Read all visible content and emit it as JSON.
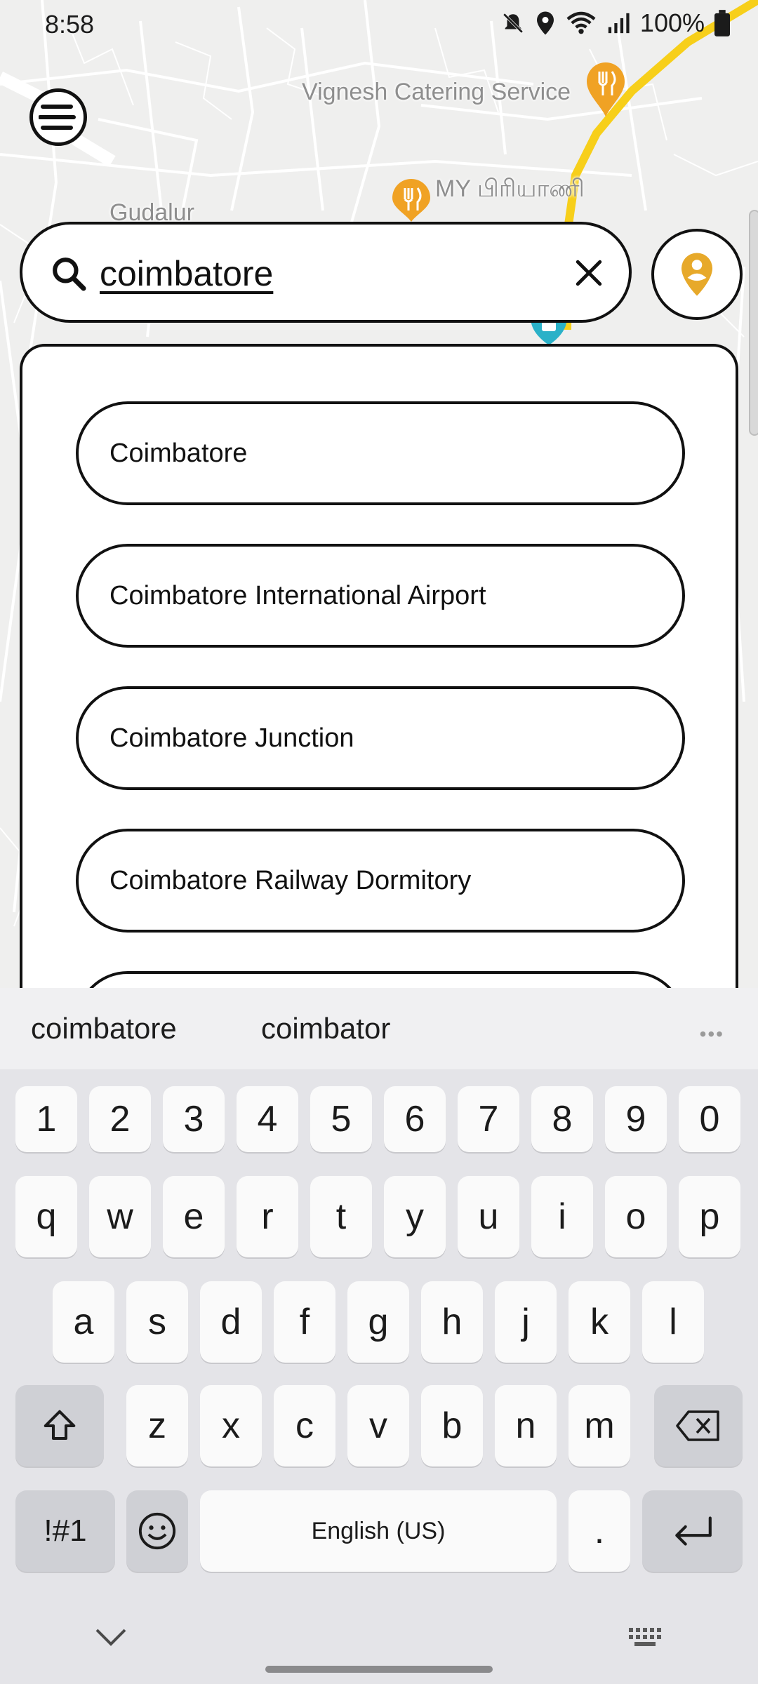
{
  "status_bar": {
    "time": "8:58",
    "battery_text": "100%",
    "icons": [
      "mute-icon",
      "location-icon",
      "wifi-icon",
      "signal-icon",
      "battery-icon"
    ]
  },
  "map": {
    "labels": {
      "vignesh": "Vignesh Catering Service",
      "my_biryani": "MY பிரியாணி",
      "gudalur": "Gudalur"
    },
    "colors": {
      "road_main": "#f7cf1a",
      "poi": "#f0a224",
      "transit": "#2ab1c8"
    }
  },
  "menu_button": {
    "icon": "menu-icon"
  },
  "search": {
    "value": "coimbatore",
    "clear_icon": "close-icon",
    "search_icon": "search-icon"
  },
  "location_button": {
    "icon": "person-pin-icon",
    "color": "#e7a92a"
  },
  "suggestions": [
    {
      "label": "Coimbatore"
    },
    {
      "label": "Coimbatore International Airport"
    },
    {
      "label": "Coimbatore Junction"
    },
    {
      "label": "Coimbatore Railway Dormitory"
    },
    {
      "label": ""
    }
  ],
  "keyboard": {
    "predictions": [
      "coimbatore",
      "coimbator"
    ],
    "more_icon": "more-horizontal-icon",
    "rows": {
      "numbers": [
        "1",
        "2",
        "3",
        "4",
        "5",
        "6",
        "7",
        "8",
        "9",
        "0"
      ],
      "row1": [
        "q",
        "w",
        "e",
        "r",
        "t",
        "y",
        "u",
        "i",
        "o",
        "p"
      ],
      "row2": [
        "a",
        "s",
        "d",
        "f",
        "g",
        "h",
        "j",
        "k",
        "l"
      ],
      "row3": [
        "z",
        "x",
        "c",
        "v",
        "b",
        "n",
        "m"
      ]
    },
    "symbols_label": "!#1",
    "space_label": "English (US)",
    "period_label": ".",
    "icons": {
      "shift": "shift-icon",
      "backspace": "backspace-icon",
      "emoji": "emoji-icon",
      "enter": "enter-icon",
      "hide": "chevron-down-icon",
      "switch_keyboard": "keyboard-icon"
    }
  }
}
